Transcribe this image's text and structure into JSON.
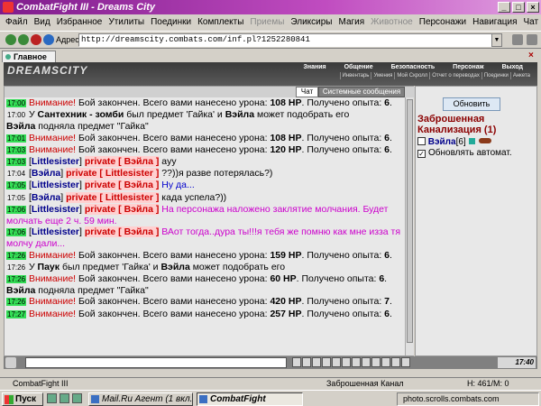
{
  "window": {
    "title": "CombatFight III - Dreams City"
  },
  "menu": [
    "Файл",
    "Вид",
    "Избранное",
    "Утилиты",
    "Поединки",
    "Комплекты",
    "Приемы",
    "Эликсиры",
    "Магия",
    "Животное",
    "Персонажи",
    "Навигация",
    "Чат",
    "Форум",
    "Окно"
  ],
  "menu_disabled": [
    "Приемы",
    "Животное"
  ],
  "toolbar": {
    "address_label": "Адрес",
    "address_value": "http://dreamscity.combats.com/inf.pl?1252280841"
  },
  "tab": {
    "label": "Главное"
  },
  "game_header": {
    "logo": "DREAMSCITY",
    "top_nav": [
      "Знания",
      "Общение",
      "Безопасность",
      "Персонаж",
      "Выход"
    ],
    "sub_nav": [
      "Инвентарь",
      "Умения",
      "Мой Скролл",
      "Отчет о переводах",
      "Поединки",
      "Анкета"
    ]
  },
  "chat_tabs": {
    "chat": "Чат",
    "system": "Системные сообщения"
  },
  "chat_lines": [
    [
      {
        "t": "17:00",
        "c": "ts green"
      },
      {
        "t": " "
      },
      {
        "t": "Внимание! ",
        "c": "alert"
      },
      {
        "t": "Бой закончен. Всего вами нанесено урона: "
      },
      {
        "t": "108 HP",
        "c": "bold"
      },
      {
        "t": ". Получено опыта: "
      },
      {
        "t": "6",
        "c": "bold"
      },
      {
        "t": "."
      }
    ],
    [
      {
        "t": "17:00",
        "c": "ts plain"
      },
      {
        "t": " У "
      },
      {
        "t": "Сантехник - зомби",
        "c": "bold"
      },
      {
        "t": " был предмет 'Гайка' и "
      },
      {
        "t": "Вэйла",
        "c": "bold"
      },
      {
        "t": " может подобрать его"
      }
    ],
    [
      {
        "t": "Вэйла",
        "c": "bold"
      },
      {
        "t": " подняла предмет \"Гайка\""
      }
    ],
    [
      {
        "t": "17:01",
        "c": "ts green"
      },
      {
        "t": " "
      },
      {
        "t": "Внимание! ",
        "c": "alert"
      },
      {
        "t": "Бой закончен. Всего вами нанесено урона: "
      },
      {
        "t": "108 HP",
        "c": "bold"
      },
      {
        "t": ". Получено опыта: "
      },
      {
        "t": "6",
        "c": "bold"
      },
      {
        "t": "."
      }
    ],
    [
      {
        "t": "17:03",
        "c": "ts green"
      },
      {
        "t": " "
      },
      {
        "t": "Внимание! ",
        "c": "alert"
      },
      {
        "t": "Бой закончен. Всего вами нанесено урона: "
      },
      {
        "t": "120 HP",
        "c": "bold"
      },
      {
        "t": ". Получено опыта: "
      },
      {
        "t": "6",
        "c": "bold"
      },
      {
        "t": "."
      }
    ],
    [
      {
        "t": "17:03",
        "c": "ts green"
      },
      {
        "t": " ["
      },
      {
        "t": "Littlesister",
        "c": "nick"
      },
      {
        "t": "] "
      },
      {
        "t": "private [ Вэйла ]",
        "c": "priv privtag"
      },
      {
        "t": " ayy"
      }
    ],
    [
      {
        "t": "17:04",
        "c": "ts plain"
      },
      {
        "t": " ["
      },
      {
        "t": "Вэйла",
        "c": "nick"
      },
      {
        "t": "] "
      },
      {
        "t": "private [ Littlesister ]",
        "c": "priv privtag"
      },
      {
        "t": " ??))я разве потерялась?)"
      }
    ],
    [
      {
        "t": "17:05",
        "c": "ts green"
      },
      {
        "t": " ["
      },
      {
        "t": "Littlesister",
        "c": "nick"
      },
      {
        "t": "] "
      },
      {
        "t": "private [ Вэйла ]",
        "c": "priv privtag"
      },
      {
        "t": " Ну да...",
        "c": "blue"
      }
    ],
    [
      {
        "t": "17:05",
        "c": "ts plain"
      },
      {
        "t": " ["
      },
      {
        "t": "Вэйла",
        "c": "nick"
      },
      {
        "t": "] "
      },
      {
        "t": "private [ Littlesister ]",
        "c": "priv privtag"
      },
      {
        "t": " када успела?))"
      }
    ],
    [
      {
        "t": "17:06",
        "c": "ts green"
      },
      {
        "t": " ["
      },
      {
        "t": "Littlesister",
        "c": "nick"
      },
      {
        "t": "] "
      },
      {
        "t": "private [ Вэйла ]",
        "c": "priv privtag"
      },
      {
        "t": " На персонажа наложено заклятие молчания. Будет молчать еще 2 ч. 59 мин.",
        "c": "magenta"
      }
    ],
    [
      {
        "t": "17:06",
        "c": "ts green"
      },
      {
        "t": " ["
      },
      {
        "t": "Littlesister",
        "c": "nick"
      },
      {
        "t": "] "
      },
      {
        "t": "private [ Вэйла ]",
        "c": "priv privtag"
      },
      {
        "t": " ВАот тогда..дура ты!!!я тебя же помню как мне изза тя молчу дали...",
        "c": "magenta"
      }
    ],
    [
      {
        "t": "17:26",
        "c": "ts green"
      },
      {
        "t": " "
      },
      {
        "t": "Внимание! ",
        "c": "alert"
      },
      {
        "t": "Бой закончен. Всего вами нанесено урона: "
      },
      {
        "t": "159 HP",
        "c": "bold"
      },
      {
        "t": ". Получено опыта: "
      },
      {
        "t": "6",
        "c": "bold"
      },
      {
        "t": "."
      }
    ],
    [
      {
        "t": "17:26",
        "c": "ts plain"
      },
      {
        "t": " У "
      },
      {
        "t": "Паук",
        "c": "bold"
      },
      {
        "t": " был предмет 'Гайка' и "
      },
      {
        "t": "Вэйла",
        "c": "bold"
      },
      {
        "t": " может подобрать его"
      }
    ],
    [
      {
        "t": "17:26",
        "c": "ts green"
      },
      {
        "t": " "
      },
      {
        "t": "Внимание! ",
        "c": "alert"
      },
      {
        "t": "Бой закончен. Всего вами нанесено урона: "
      },
      {
        "t": "60 HP",
        "c": "bold"
      },
      {
        "t": ". Получено опыта: "
      },
      {
        "t": "6",
        "c": "bold"
      },
      {
        "t": "."
      }
    ],
    [
      {
        "t": "Вэйла",
        "c": "bold"
      },
      {
        "t": " подняла предмет \"Гайка\""
      }
    ],
    [
      {
        "t": "17:26",
        "c": "ts green"
      },
      {
        "t": " "
      },
      {
        "t": "Внимание! ",
        "c": "alert"
      },
      {
        "t": "Бой закончен. Всего вами нанесено урона: "
      },
      {
        "t": "420 HP",
        "c": "bold"
      },
      {
        "t": ". Получено опыта: "
      },
      {
        "t": "7",
        "c": "bold"
      },
      {
        "t": "."
      }
    ],
    [
      {
        "t": "17:27",
        "c": "ts green"
      },
      {
        "t": " "
      },
      {
        "t": "Внимание! ",
        "c": "alert"
      },
      {
        "t": "Бой закончен. Всего вами нанесено урона: "
      },
      {
        "t": "257 HP",
        "c": "bold"
      },
      {
        "t": ". Получено опыта: "
      },
      {
        "t": "6",
        "c": "bold"
      },
      {
        "t": "."
      }
    ]
  ],
  "right_panel": {
    "refresh_label": "Обновить",
    "location": "Заброшенная Канализация (1)",
    "player_name": "Вэйла",
    "player_level": "[6]",
    "auto_refresh_label": "Обновлять автомат.",
    "auto_refresh_checked": "✓"
  },
  "bottom_bar": {
    "clock": "17:40"
  },
  "status_bar": {
    "left": "CombatFight III",
    "location": "Заброшенная Канал",
    "hp": "H: 461/M: 0"
  },
  "taskbar": {
    "start": "Пуск",
    "tasks": [
      "Mail.Ru Агент (1 вкл...",
      "CombatFight"
    ],
    "tray": "photo.scrolls.combats.com"
  }
}
